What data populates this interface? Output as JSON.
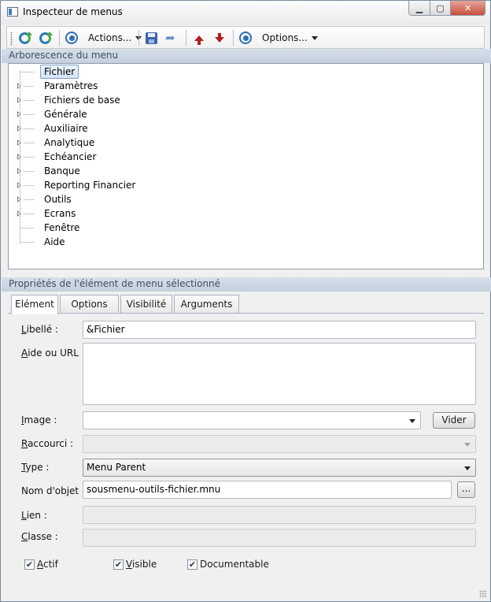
{
  "window": {
    "title": "Inspecteur de menus",
    "controls": {
      "minimize": "▁",
      "maximize": "▢",
      "close": "✕"
    }
  },
  "toolbar": {
    "actions_label": "Actions...",
    "options_label": "Options...",
    "icons": [
      "refresh-icon",
      "refresh-icon",
      "target-icon",
      "save-icon",
      "redo-icon",
      "arrow-up-icon",
      "arrow-down-icon",
      "target-icon"
    ]
  },
  "tree_section": {
    "title": "Arborescence du menu",
    "items": [
      {
        "label": "Fichier",
        "expandable": false,
        "selected": true
      },
      {
        "label": "Paramètres",
        "expandable": true,
        "selected": false
      },
      {
        "label": "Fichiers de base",
        "expandable": true,
        "selected": false
      },
      {
        "label": "Générale",
        "expandable": true,
        "selected": false
      },
      {
        "label": "Auxiliaire",
        "expandable": true,
        "selected": false
      },
      {
        "label": "Analytique",
        "expandable": true,
        "selected": false
      },
      {
        "label": "Echéancier",
        "expandable": true,
        "selected": false
      },
      {
        "label": "Banque",
        "expandable": true,
        "selected": false
      },
      {
        "label": "Reporting Financier",
        "expandable": true,
        "selected": false
      },
      {
        "label": "Outils",
        "expandable": true,
        "selected": false
      },
      {
        "label": "Ecrans",
        "expandable": true,
        "selected": false
      },
      {
        "label": "Fenêtre",
        "expandable": false,
        "selected": false
      },
      {
        "label": "Aide",
        "expandable": false,
        "selected": false
      }
    ]
  },
  "properties_section": {
    "title": "Propriétés de l'élément de menu sélectionné",
    "tabs": [
      {
        "label": "Elément",
        "active": true
      },
      {
        "label": "Options",
        "active": false
      },
      {
        "label": "Visibilité",
        "active": false
      },
      {
        "label": "Arguments",
        "active": false
      }
    ]
  },
  "form": {
    "libelle": {
      "label_key": "L",
      "label_rest": "ibellé :",
      "value": "&Fichier"
    },
    "aide": {
      "label_key": "A",
      "label_rest": "ide ou URL :",
      "value": ""
    },
    "image": {
      "label_key": "I",
      "label_rest": "mage :",
      "value": ""
    },
    "vider_label": "Vider",
    "raccourci": {
      "label_key": "R",
      "label_rest": "accourci :",
      "value": ""
    },
    "type": {
      "label_key": "T",
      "label_rest": "ype :",
      "value": "Menu Parent"
    },
    "nom_objet": {
      "label": "Nom d'objet :",
      "value": "sousmenu-outils-fichier.mnu"
    },
    "browse_label": "...",
    "lien": {
      "label_key": "L",
      "label_rest": "ien :",
      "value": ""
    },
    "classe": {
      "label_key": "C",
      "label_rest": "lasse :",
      "value": ""
    }
  },
  "checkboxes": [
    {
      "label_key": "A",
      "label_rest": "ctif",
      "checked": true
    },
    {
      "label_key": "V",
      "label_rest": "isible",
      "checked": true
    },
    {
      "label_key": "",
      "label_rest": "Documentable",
      "checked": true
    }
  ],
  "colors": {
    "section_header_bg": "#ccd7e5",
    "section_header_text": "#3f4f63",
    "selection_bg": "#dbe8f8",
    "selection_border": "#7da2ce",
    "close_button": "#c7503e"
  }
}
